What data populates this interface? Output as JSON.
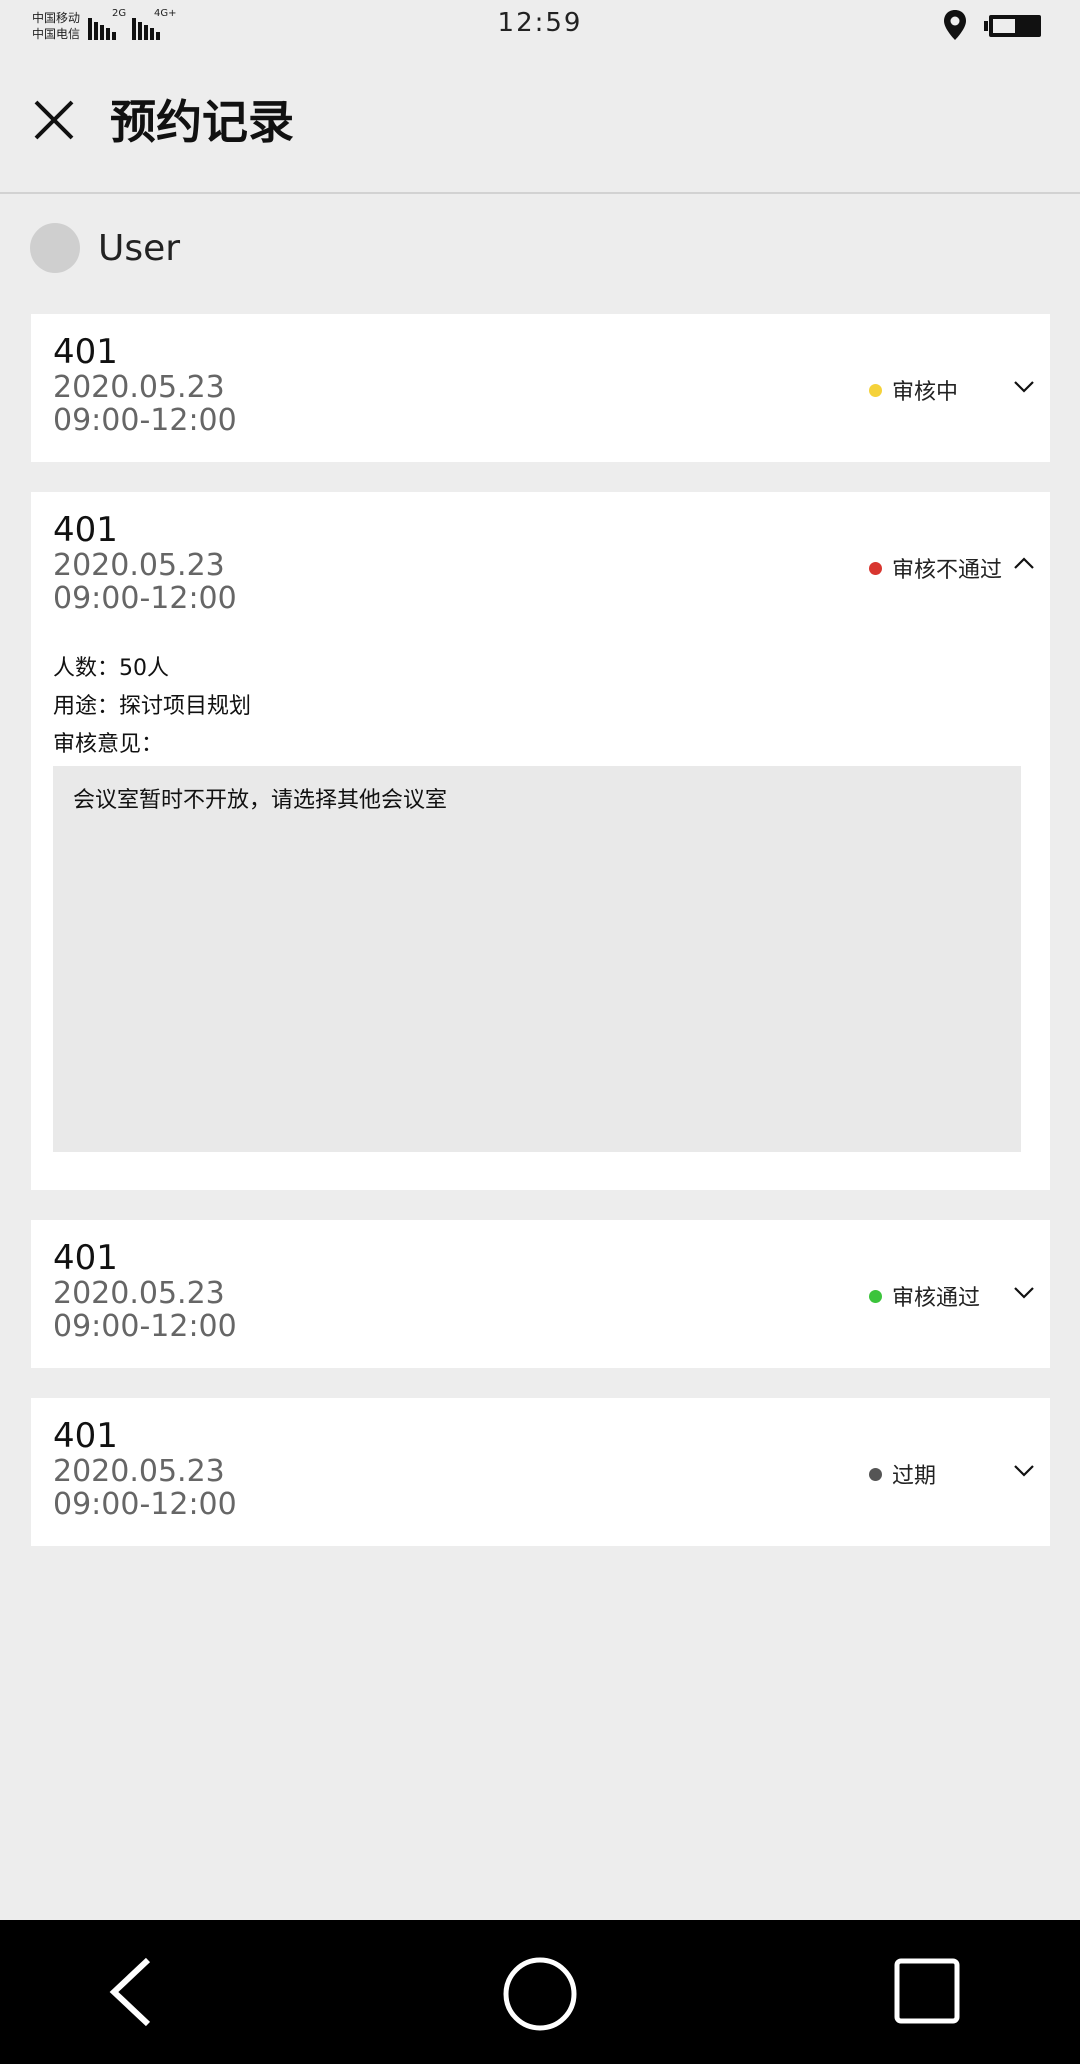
{
  "status_bar": {
    "carrier1": "中国移动",
    "carrier2": "中国电信",
    "net1": "2G",
    "net2": "4G+",
    "time": "12:59"
  },
  "header": {
    "title": "预约记录",
    "close_icon": "close-icon"
  },
  "user": {
    "name": "User"
  },
  "records": [
    {
      "room": "401",
      "date": "2020.05.23",
      "time": "09:00-12:00",
      "status": "审核中",
      "status_color": "#f5d23a",
      "expanded": false
    },
    {
      "room": "401",
      "date": "2020.05.23",
      "time": "09:00-12:00",
      "status": "审核不通过",
      "status_color": "#d8362f",
      "expanded": true,
      "details": {
        "people": "人数：50人",
        "purpose": "用途：探讨项目规划",
        "opinion_label": "审核意见：",
        "opinion": "会议室暂时不开放，请选择其他会议室"
      }
    },
    {
      "room": "401",
      "date": "2020.05.23",
      "time": "09:00-12:00",
      "status": "审核通过",
      "status_color": "#3cc43c",
      "expanded": false
    },
    {
      "room": "401",
      "date": "2020.05.23",
      "time": "09:00-12:00",
      "status": "过期",
      "status_color": "#555555",
      "expanded": false
    }
  ],
  "nav_bar": {
    "back_icon": "back-icon",
    "home_icon": "home-icon",
    "recents_icon": "recents-icon"
  }
}
